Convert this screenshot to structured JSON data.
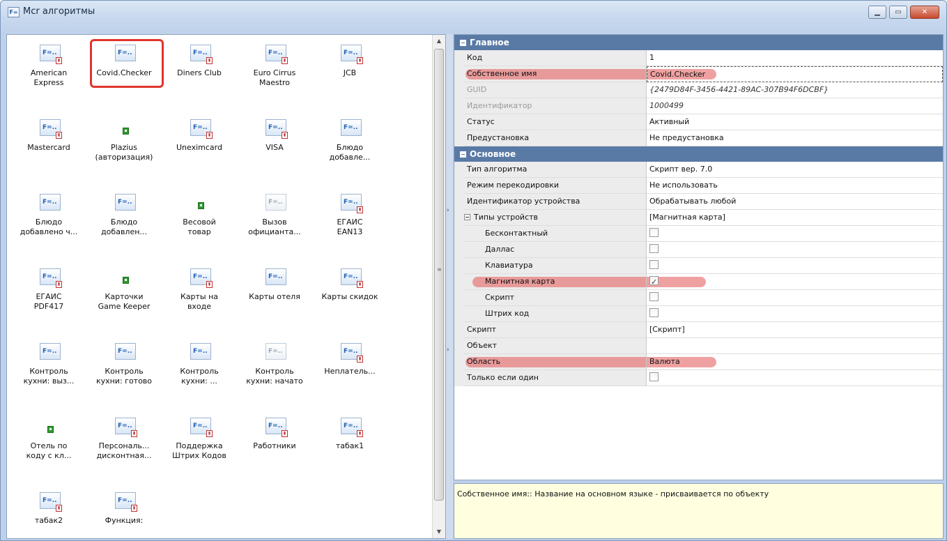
{
  "window": {
    "title": "Mcr алгоритмы",
    "app_icon_text": "F="
  },
  "algorithms": [
    {
      "label": "American\nExpress",
      "icon": "script-red-icon"
    },
    {
      "label": "Covid.Checker",
      "icon": "script-icon",
      "selected": true
    },
    {
      "label": "Diners Club",
      "icon": "script-red-icon"
    },
    {
      "label": "Euro Cirrus\nMaestro",
      "icon": "script-red-icon"
    },
    {
      "label": "JCB",
      "icon": "script-red-icon"
    },
    {
      "label": "Mastercard",
      "icon": "script-red-icon"
    },
    {
      "label": "Plazius\n(авторизация)",
      "icon": "plugin-icon"
    },
    {
      "label": "Uneximcard",
      "icon": "script-red-icon"
    },
    {
      "label": "VISA",
      "icon": "script-red-icon"
    },
    {
      "label": "Блюдо\nдобавле...",
      "icon": "script-icon"
    },
    {
      "label": "Блюдо\nдобавлено ч...",
      "icon": "script-icon"
    },
    {
      "label": "Блюдо\nдобавлен...",
      "icon": "script-icon"
    },
    {
      "label": "Весовой\nтовар",
      "icon": "plugin-icon"
    },
    {
      "label": "Вызов\nофицианта...",
      "icon": "script-gray-icon"
    },
    {
      "label": "ЕГАИС\nEAN13",
      "icon": "script-red-icon"
    },
    {
      "label": "ЕГАИС\nPDF417",
      "icon": "script-red-icon"
    },
    {
      "label": "Карточки\nGame Keeper",
      "icon": "plugin-icon"
    },
    {
      "label": "Карты на\nвходе",
      "icon": "script-red-icon"
    },
    {
      "label": "Карты отеля",
      "icon": "script-icon"
    },
    {
      "label": "Карты скидок",
      "icon": "script-red-icon"
    },
    {
      "label": "Контроль\nкухни: выз...",
      "icon": "script-icon"
    },
    {
      "label": "Контроль\nкухни: готово",
      "icon": "script-icon"
    },
    {
      "label": "Контроль\nкухни: ...",
      "icon": "script-icon"
    },
    {
      "label": "Контроль\nкухни: начато",
      "icon": "script-gray-icon"
    },
    {
      "label": "Неплатель...",
      "icon": "script-red-icon"
    },
    {
      "label": "Отель по\nкоду с кл...",
      "icon": "plugin-icon"
    },
    {
      "label": "Персональ...\nдисконтная...",
      "icon": "script-red-icon"
    },
    {
      "label": "Поддержка\nШтрих Кодов",
      "icon": "script-red-icon"
    },
    {
      "label": "Работники",
      "icon": "script-red-icon"
    },
    {
      "label": "табак1",
      "icon": "script-red-icon"
    },
    {
      "label": "табак2",
      "icon": "script-red-icon"
    },
    {
      "label": "Функция:",
      "icon": "script-red-icon"
    }
  ],
  "properties": {
    "cat_main": "Главное",
    "main_rows": [
      {
        "name": "Код",
        "value": "1"
      },
      {
        "name": "Собственное имя",
        "value": "Covid.Checker",
        "highlight": true,
        "focused": true
      },
      {
        "name": "GUID",
        "value": "{2479D84F-3456-4421-89AC-307B94F6DCBF}",
        "disabled": true,
        "italic": true
      },
      {
        "name": "Идентификатор",
        "value": "1000499",
        "disabled": true,
        "italic": true
      },
      {
        "name": "Статус",
        "value": "Активный"
      },
      {
        "name": "Предустановка",
        "value": "Не предустановка"
      }
    ],
    "cat_basic": "Основное",
    "basic_rows": [
      {
        "name": "Тип алгоритма",
        "value": "Скрипт вер. 7.0"
      },
      {
        "name": "Режим перекодировки",
        "value": "Не использовать"
      },
      {
        "name": "Идентификатор устройства",
        "value": "Обрабатывать любой"
      },
      {
        "name": "Типы устройств",
        "value": "[Магнитная карта]",
        "group": true
      },
      {
        "name": "Бесконтактный",
        "checkbox": true,
        "checked": false,
        "sub": true
      },
      {
        "name": "Даллас",
        "checkbox": true,
        "checked": false,
        "sub": true
      },
      {
        "name": "Клавиатура",
        "checkbox": true,
        "checked": false,
        "sub": true
      },
      {
        "name": "Магнитная карта",
        "checkbox": true,
        "checked": true,
        "sub": true,
        "highlight": true
      },
      {
        "name": "Скрипт",
        "checkbox": true,
        "checked": false,
        "sub": true
      },
      {
        "name": "Штрих код",
        "checkbox": true,
        "checked": false,
        "sub": true
      },
      {
        "name": "Скрипт",
        "value": "[Скрипт]"
      },
      {
        "name": "Объект",
        "value": ""
      },
      {
        "name": "Область",
        "value": "Валюта",
        "highlight": true
      },
      {
        "name": "Только если один",
        "checkbox": true,
        "checked": false
      }
    ]
  },
  "help": {
    "text": "Собственное имя:: Название на основном языке - присваивается по объекту"
  },
  "splitter": {
    "arrow": "›"
  },
  "colors": {
    "category_bg": "#5a7aa6",
    "highlight": "#e66e6e",
    "selection_frame": "#e0342c"
  }
}
